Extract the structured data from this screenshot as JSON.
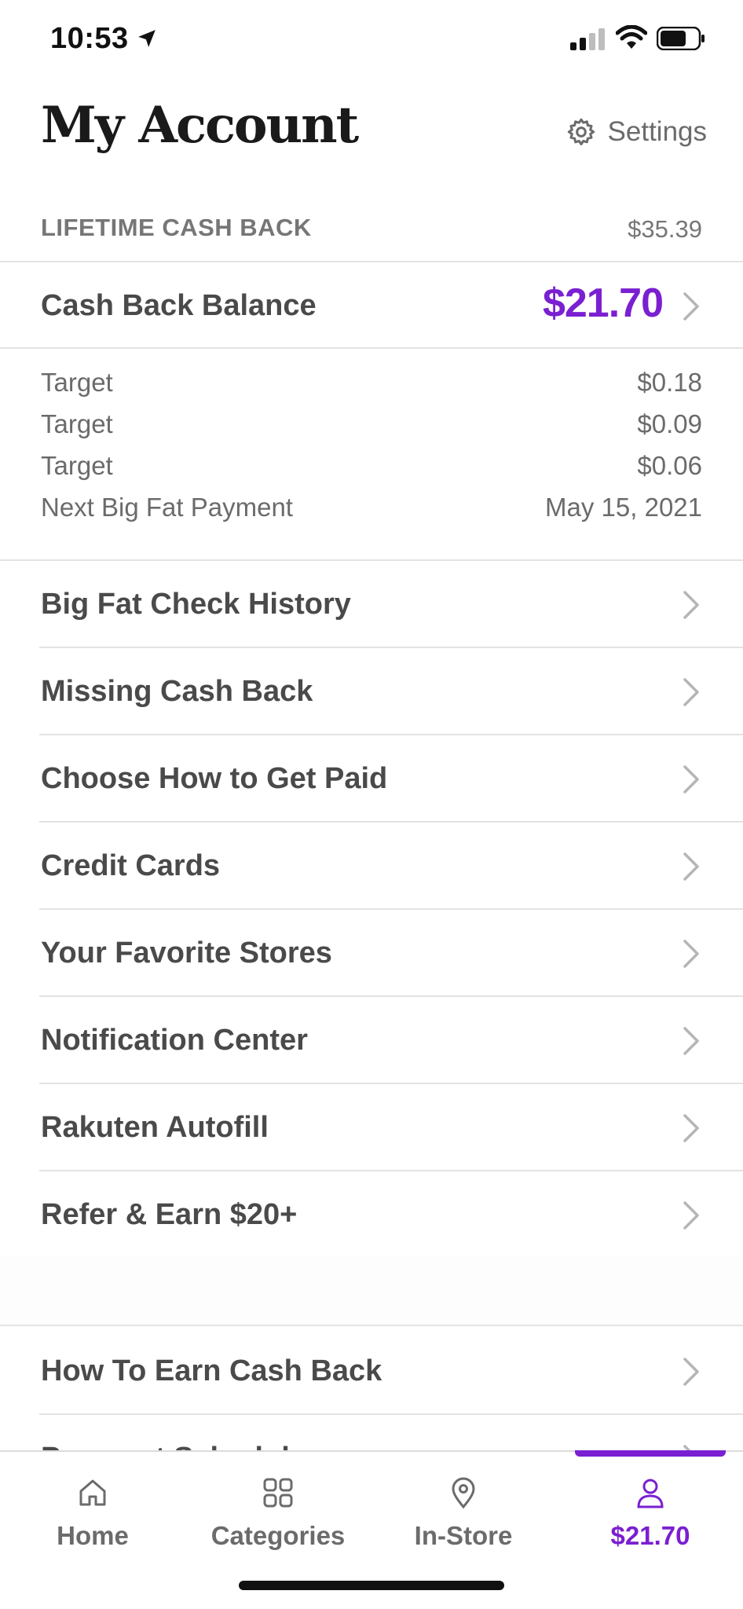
{
  "status_bar": {
    "time": "10:53"
  },
  "header": {
    "title": "My Account",
    "settings_label": "Settings"
  },
  "lifetime": {
    "label": "LIFETIME CASH BACK",
    "value": "$35.39"
  },
  "balance": {
    "label": "Cash Back Balance",
    "value": "$21.70"
  },
  "pending": [
    {
      "label": "Target",
      "value": "$0.18"
    },
    {
      "label": "Target",
      "value": "$0.09"
    },
    {
      "label": "Target",
      "value": "$0.06"
    },
    {
      "label": "Next Big Fat Payment",
      "value": "May 15, 2021"
    }
  ],
  "menu": [
    {
      "label": "Big Fat Check History"
    },
    {
      "label": "Missing Cash Back"
    },
    {
      "label": "Choose How to Get Paid"
    },
    {
      "label": "Credit Cards"
    },
    {
      "label": "Your Favorite Stores"
    },
    {
      "label": "Notification Center"
    },
    {
      "label": "Rakuten Autofill"
    },
    {
      "label": "Refer & Earn $20+"
    }
  ],
  "menu2": [
    {
      "label": "How To Earn Cash Back"
    },
    {
      "label": "Payment Schedule"
    }
  ],
  "tabs": [
    {
      "label": "Home",
      "icon": "home-icon"
    },
    {
      "label": "Categories",
      "icon": "grid-icon"
    },
    {
      "label": "In-Store",
      "icon": "location-pin-icon"
    },
    {
      "label": "$21.70",
      "icon": "person-icon"
    }
  ],
  "colors": {
    "accent": "#7a1fd1",
    "text": "#4a4a4a",
    "muted": "#6b6b6b",
    "divider": "#e3e3e3"
  }
}
